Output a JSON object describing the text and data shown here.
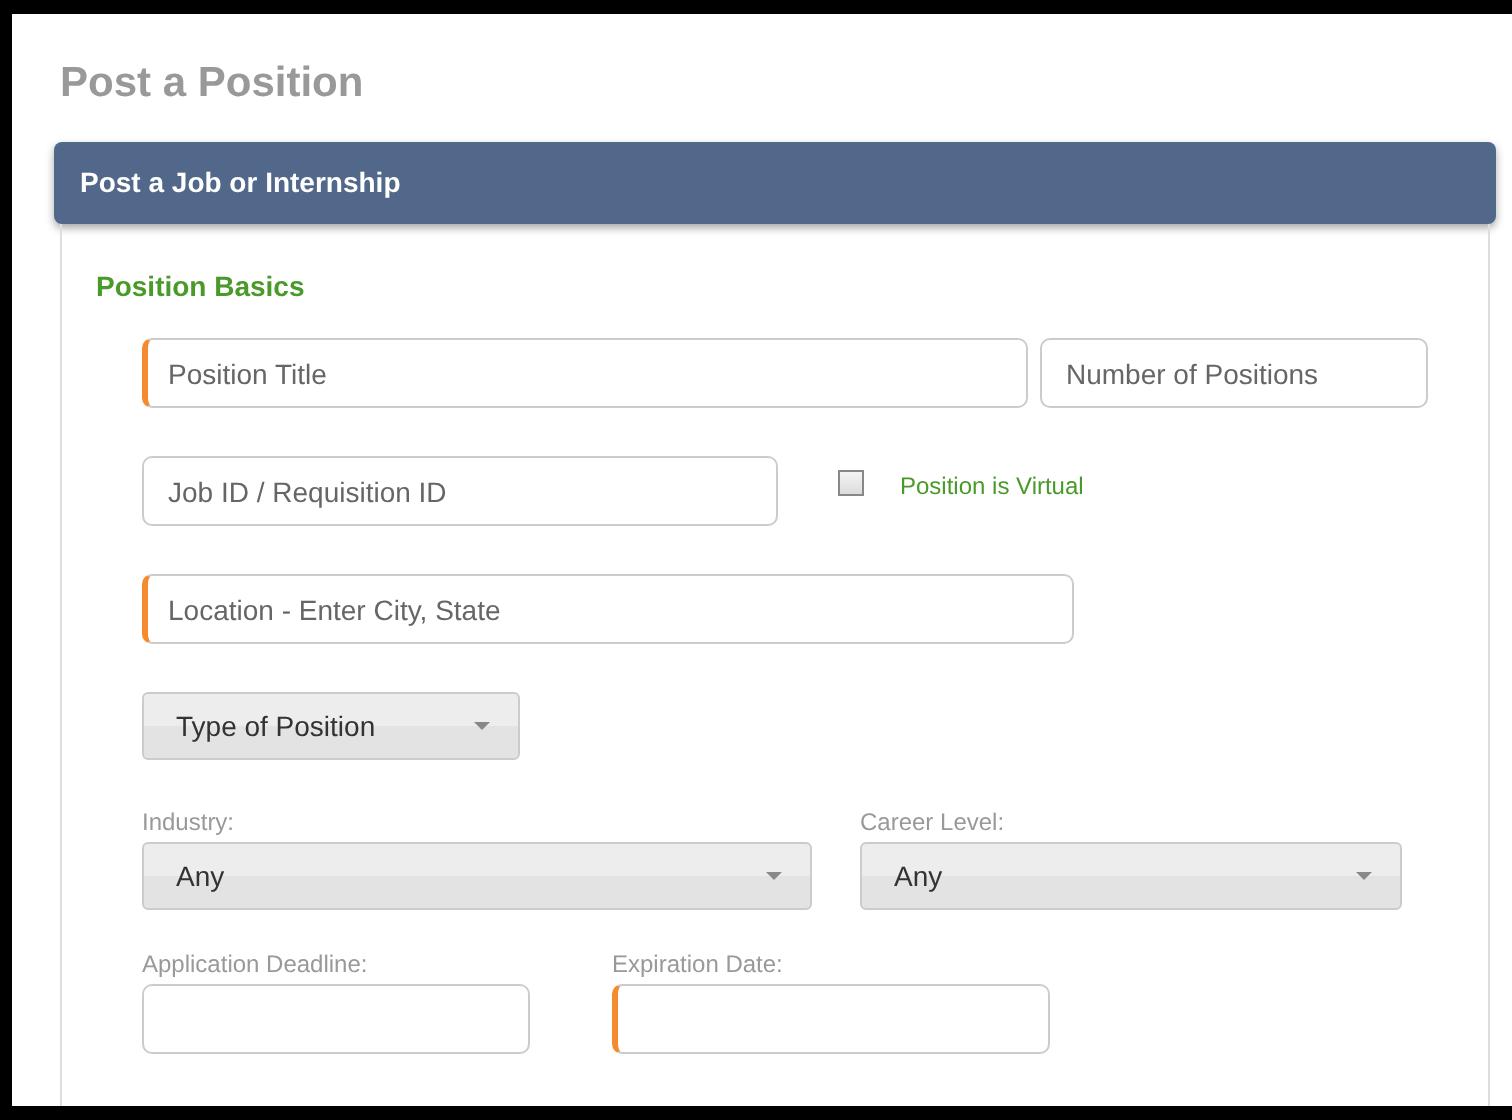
{
  "page_title": "Post a Position",
  "panel": {
    "title": "Post a Job or Internship",
    "section": "Position Basics",
    "rows": [
      [
        {
          "kind": "text",
          "placeholder": "Position Title",
          "required": true
        },
        {
          "kind": "text",
          "placeholder": "Number of Positions",
          "required": false
        }
      ],
      [
        {
          "kind": "text",
          "placeholder": "Job ID / Requisition ID",
          "required": false
        },
        {
          "kind": "checkbox",
          "label": "Position is Virtual",
          "checked": false
        }
      ],
      [
        {
          "kind": "text",
          "placeholder": "Location - Enter City, State",
          "required": true
        }
      ],
      [
        {
          "kind": "select",
          "value": "Type of Position"
        }
      ],
      [
        {
          "kind": "select",
          "label": "Industry:",
          "value": "Any"
        },
        {
          "kind": "select",
          "label": "Career Level:",
          "value": "Any"
        }
      ],
      [
        {
          "kind": "text",
          "label": "Application Deadline:",
          "required": false
        },
        {
          "kind": "text",
          "label": "Expiration Date:",
          "required": true
        }
      ]
    ]
  }
}
